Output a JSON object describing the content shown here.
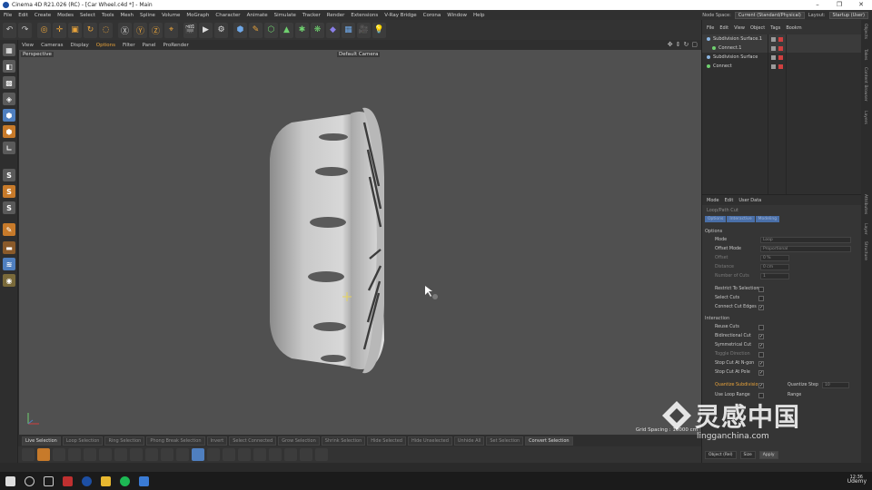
{
  "window": {
    "title": "Cinema 4D R21.026 (RC) - [Car Wheel.c4d *] - Main",
    "controls": [
      "–",
      "❐",
      "✕"
    ]
  },
  "menubar": {
    "items": [
      "File",
      "Edit",
      "Create",
      "Modes",
      "Select",
      "Tools",
      "Mesh",
      "Spline",
      "Volume",
      "MoGraph",
      "Character",
      "Animate",
      "Simulate",
      "Tracker",
      "Render",
      "Extensions",
      "V-Ray Bridge",
      "Corona",
      "Window",
      "Help"
    ],
    "node_space_label": "Node Space:",
    "node_space_value": "Current (Standard/Physical)",
    "layout_label": "Layout:",
    "layout_value": "Startup (User)"
  },
  "viewport": {
    "menu": [
      "View",
      "Cameras",
      "Display",
      "Options",
      "Filter",
      "Panel",
      "ProRender"
    ],
    "active_menu_index": 3,
    "label": "Perspective",
    "camera": "Default Camera",
    "grid_spacing": "Grid Spacing : 10000 cm"
  },
  "selection_modes": [
    "Live Selection",
    "Loop Selection",
    "Ring Selection",
    "Phong Break Selection",
    "Invert",
    "Select Connected",
    "Grow Selection",
    "Shrink Selection",
    "Hide Selected",
    "Hide Unselected",
    "Unhide All",
    "Set Selection",
    "Convert Selection"
  ],
  "active_selection_indices": [
    0,
    12
  ],
  "object_manager": {
    "menu": [
      "File",
      "Edit",
      "View",
      "Object",
      "Tags",
      "Bookm"
    ],
    "objects": [
      {
        "name": "Subdivision Surface.1",
        "indent": 0,
        "selected": true
      },
      {
        "name": "Connect.1",
        "indent": 1,
        "selected": true
      },
      {
        "name": "Subdivision Surface",
        "indent": 0,
        "selected": false
      },
      {
        "name": "Connect",
        "indent": 0,
        "selected": false
      }
    ]
  },
  "attributes": {
    "menu": [
      "Mode",
      "Edit",
      "User Data"
    ],
    "tool_title": "Loop/Path Cut",
    "tabs": [
      "Options",
      "Interactive",
      "Modeling"
    ],
    "options_header": "Options",
    "mode_label": "Mode",
    "mode_value": "Loop",
    "offset_mode_label": "Offset Mode",
    "offset_mode_value": "Proportional",
    "offset_label": "Offset",
    "offset_value": "0 %",
    "distance_label": "Distance",
    "distance_value": "0 cm",
    "num_cuts_label": "Number of Cuts",
    "num_cuts_value": "1",
    "restrict_label": "Restrict To Selection",
    "select_cuts_label": "Select Cuts",
    "connect_edges_label": "Connect Cut Edges",
    "interaction_header": "Interaction",
    "reuse_label": "Reuse Cuts",
    "bidirectional_label": "Bidirectional Cut",
    "symmetrical_label": "Symmetrical Cut",
    "toggle_dir_label": "Toggle Direction",
    "stop_ngon_label": "Stop Cut At N-gon",
    "stop_pole_label": "Stop Cut At Pole",
    "quantize_label": "Quantize Subdivision",
    "quantize_step_label": "Quantize Step",
    "quantize_step_value": "10",
    "use_loop_range_label": "Use Loop Range",
    "range_label": "Range",
    "object_rel": "Object (Rel)",
    "size": "Size",
    "apply": "Apply"
  },
  "right_tabs": [
    "Objects",
    "Takes",
    "Content Browser",
    "Layers",
    "Attributes",
    "Layer",
    "Structure"
  ],
  "watermark": {
    "main": "灵感中国",
    "sub": "lingganchina.com"
  },
  "corner_brand": "Udemy",
  "taskbar": {
    "time": "12:36"
  }
}
